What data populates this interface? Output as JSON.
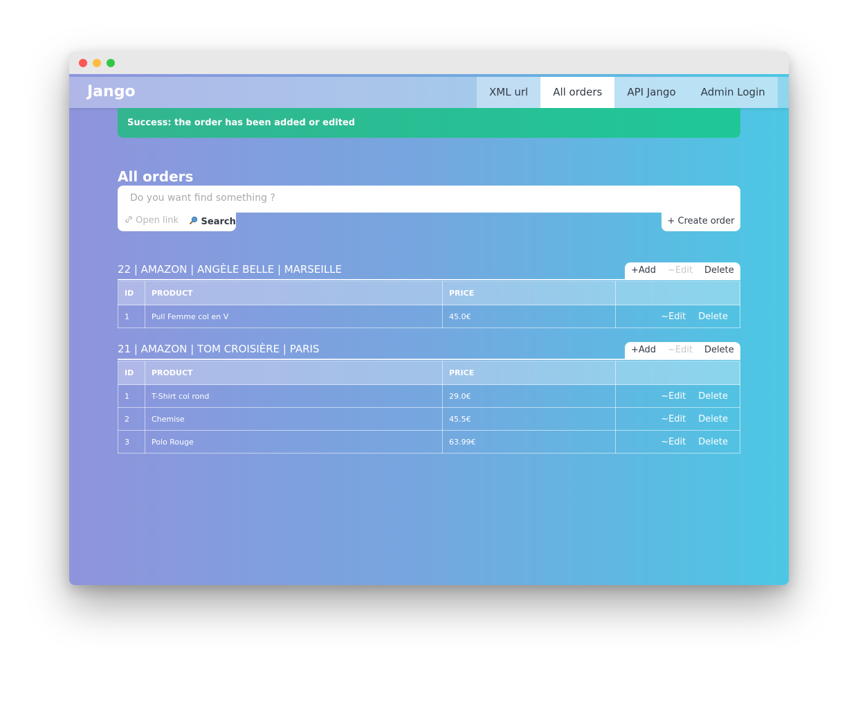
{
  "window": {
    "traffic_lights": [
      "close",
      "minimize",
      "maximize"
    ]
  },
  "navbar": {
    "brand": "Jango",
    "tabs": [
      {
        "label": "XML url",
        "active": false
      },
      {
        "label": "All orders",
        "active": true
      },
      {
        "label": "API Jango",
        "active": false
      },
      {
        "label": "Admin Login",
        "active": false
      }
    ]
  },
  "alert": {
    "message": "Success: the order has been added or edited",
    "color": "#1fc797"
  },
  "main": {
    "title": "All orders",
    "search": {
      "placeholder": "Do you want find something ?",
      "open_link_label": "Open link",
      "search_label": "Search",
      "create_order_label": "+ Create order",
      "open_link_icon": "link-icon",
      "search_icon": "magnifier-icon"
    },
    "columns": {
      "id": "ID",
      "product": "PRODUCT",
      "price": "PRICE"
    },
    "order_actions": {
      "add": "+Add",
      "edit": "~Edit",
      "delete": "Delete"
    },
    "row_actions": {
      "edit": "~Edit",
      "delete": "Delete"
    },
    "orders": [
      {
        "title": "22 | AMAZON | ANGÈLE BELLE | MARSEILLE",
        "items": [
          {
            "id": "1",
            "product": "Pull Femme col en V",
            "price": "45.0€"
          }
        ]
      },
      {
        "title": "21 | AMAZON | TOM CROISIÈRE | PARIS",
        "items": [
          {
            "id": "1",
            "product": "T-Shirt col rond",
            "price": "29.0€"
          },
          {
            "id": "2",
            "product": "Chemise",
            "price": "45.5€"
          },
          {
            "id": "3",
            "product": "Polo Rouge",
            "price": "63.99€"
          }
        ]
      }
    ]
  }
}
